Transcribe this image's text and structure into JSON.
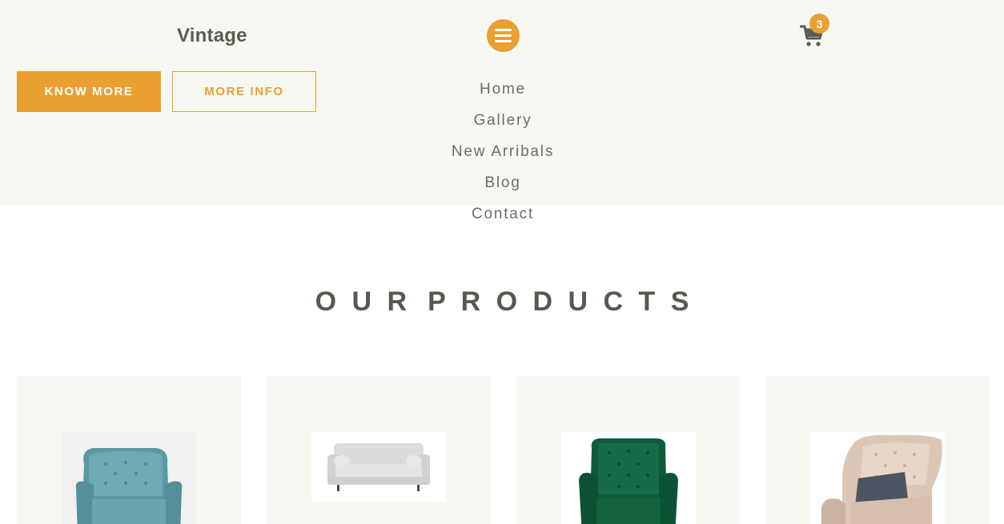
{
  "brand": {
    "name": "Vintage"
  },
  "header": {
    "menu_icon": "hamburger-icon",
    "cart_icon": "shopping-cart-icon",
    "cart_count": "3",
    "accent_color": "#ea9f31"
  },
  "hero": {
    "primary_button": "KNOW MORE",
    "secondary_button": "MORE INFO"
  },
  "nav": {
    "items": [
      "Home",
      "Gallery",
      "New Arribals",
      "Blog",
      "Contact"
    ]
  },
  "products_section": {
    "title_words": [
      "O U R",
      "P R O D U C T S"
    ],
    "cards": [
      {
        "image": "blue-tufted-wingback-armchair"
      },
      {
        "image": "light-grey-sofa"
      },
      {
        "image": "green-velvet-tufted-armchair"
      },
      {
        "image": "beige-tufted-wingback-armchair"
      }
    ]
  }
}
